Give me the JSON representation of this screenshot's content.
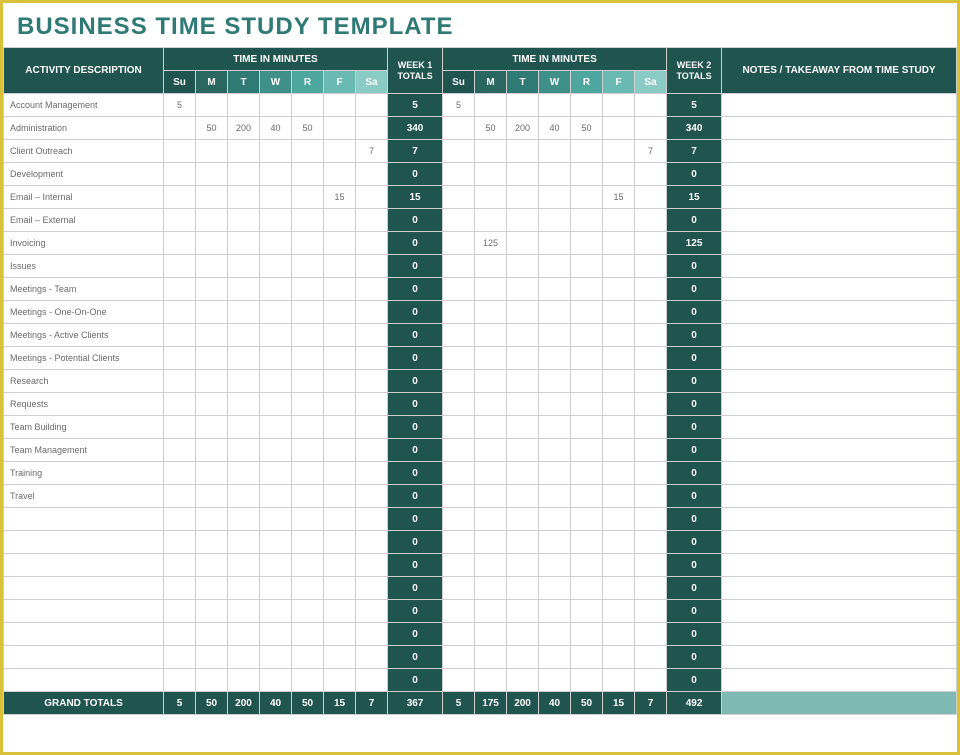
{
  "title": "BUSINESS TIME STUDY TEMPLATE",
  "headers": {
    "activity": "ACTIVITY DESCRIPTION",
    "time_in_minutes": "TIME IN MINUTES",
    "week1_totals": "WEEK 1 TOTALS",
    "week2_totals": "WEEK 2 TOTALS",
    "notes": "NOTES / TAKEAWAY FROM TIME STUDY",
    "days": [
      "Su",
      "M",
      "T",
      "W",
      "R",
      "F",
      "Sa"
    ],
    "grand_totals": "GRAND TOTALS"
  },
  "rows": [
    {
      "activity": "Account Management",
      "w1": [
        "5",
        "",
        "",
        "",
        "",
        "",
        ""
      ],
      "t1": "5",
      "w2": [
        "5",
        "",
        "",
        "",
        "",
        "",
        ""
      ],
      "t2": "5",
      "notes": ""
    },
    {
      "activity": "Administration",
      "w1": [
        "",
        "50",
        "200",
        "40",
        "50",
        "",
        ""
      ],
      "t1": "340",
      "w2": [
        "",
        "50",
        "200",
        "40",
        "50",
        "",
        ""
      ],
      "t2": "340",
      "notes": ""
    },
    {
      "activity": "Client Outreach",
      "w1": [
        "",
        "",
        "",
        "",
        "",
        "",
        "7"
      ],
      "t1": "7",
      "w2": [
        "",
        "",
        "",
        "",
        "",
        "",
        "7"
      ],
      "t2": "7",
      "notes": ""
    },
    {
      "activity": "Development",
      "w1": [
        "",
        "",
        "",
        "",
        "",
        "",
        ""
      ],
      "t1": "0",
      "w2": [
        "",
        "",
        "",
        "",
        "",
        "",
        ""
      ],
      "t2": "0",
      "notes": ""
    },
    {
      "activity": "Email – Internal",
      "w1": [
        "",
        "",
        "",
        "",
        "",
        "15",
        ""
      ],
      "t1": "15",
      "w2": [
        "",
        "",
        "",
        "",
        "",
        "15",
        ""
      ],
      "t2": "15",
      "notes": ""
    },
    {
      "activity": "Email – External",
      "w1": [
        "",
        "",
        "",
        "",
        "",
        "",
        ""
      ],
      "t1": "0",
      "w2": [
        "",
        "",
        "",
        "",
        "",
        "",
        ""
      ],
      "t2": "0",
      "notes": ""
    },
    {
      "activity": "Invoicing",
      "w1": [
        "",
        "",
        "",
        "",
        "",
        "",
        ""
      ],
      "t1": "0",
      "w2": [
        "",
        "125",
        "",
        "",
        "",
        "",
        ""
      ],
      "t2": "125",
      "notes": ""
    },
    {
      "activity": "Issues",
      "w1": [
        "",
        "",
        "",
        "",
        "",
        "",
        ""
      ],
      "t1": "0",
      "w2": [
        "",
        "",
        "",
        "",
        "",
        "",
        ""
      ],
      "t2": "0",
      "notes": ""
    },
    {
      "activity": "Meetings - Team",
      "w1": [
        "",
        "",
        "",
        "",
        "",
        "",
        ""
      ],
      "t1": "0",
      "w2": [
        "",
        "",
        "",
        "",
        "",
        "",
        ""
      ],
      "t2": "0",
      "notes": ""
    },
    {
      "activity": "Meetings - One-On-One",
      "w1": [
        "",
        "",
        "",
        "",
        "",
        "",
        ""
      ],
      "t1": "0",
      "w2": [
        "",
        "",
        "",
        "",
        "",
        "",
        ""
      ],
      "t2": "0",
      "notes": ""
    },
    {
      "activity": "Meetings - Active Clients",
      "w1": [
        "",
        "",
        "",
        "",
        "",
        "",
        ""
      ],
      "t1": "0",
      "w2": [
        "",
        "",
        "",
        "",
        "",
        "",
        ""
      ],
      "t2": "0",
      "notes": ""
    },
    {
      "activity": "Meetings - Potential Clients",
      "w1": [
        "",
        "",
        "",
        "",
        "",
        "",
        ""
      ],
      "t1": "0",
      "w2": [
        "",
        "",
        "",
        "",
        "",
        "",
        ""
      ],
      "t2": "0",
      "notes": ""
    },
    {
      "activity": "Research",
      "w1": [
        "",
        "",
        "",
        "",
        "",
        "",
        ""
      ],
      "t1": "0",
      "w2": [
        "",
        "",
        "",
        "",
        "",
        "",
        ""
      ],
      "t2": "0",
      "notes": ""
    },
    {
      "activity": "Requests",
      "w1": [
        "",
        "",
        "",
        "",
        "",
        "",
        ""
      ],
      "t1": "0",
      "w2": [
        "",
        "",
        "",
        "",
        "",
        "",
        ""
      ],
      "t2": "0",
      "notes": ""
    },
    {
      "activity": "Team Building",
      "w1": [
        "",
        "",
        "",
        "",
        "",
        "",
        ""
      ],
      "t1": "0",
      "w2": [
        "",
        "",
        "",
        "",
        "",
        "",
        ""
      ],
      "t2": "0",
      "notes": ""
    },
    {
      "activity": "Team Management",
      "w1": [
        "",
        "",
        "",
        "",
        "",
        "",
        ""
      ],
      "t1": "0",
      "w2": [
        "",
        "",
        "",
        "",
        "",
        "",
        ""
      ],
      "t2": "0",
      "notes": ""
    },
    {
      "activity": "Training",
      "w1": [
        "",
        "",
        "",
        "",
        "",
        "",
        ""
      ],
      "t1": "0",
      "w2": [
        "",
        "",
        "",
        "",
        "",
        "",
        ""
      ],
      "t2": "0",
      "notes": ""
    },
    {
      "activity": "Travel",
      "w1": [
        "",
        "",
        "",
        "",
        "",
        "",
        ""
      ],
      "t1": "0",
      "w2": [
        "",
        "",
        "",
        "",
        "",
        "",
        ""
      ],
      "t2": "0",
      "notes": ""
    },
    {
      "activity": "",
      "w1": [
        "",
        "",
        "",
        "",
        "",
        "",
        ""
      ],
      "t1": "0",
      "w2": [
        "",
        "",
        "",
        "",
        "",
        "",
        ""
      ],
      "t2": "0",
      "notes": ""
    },
    {
      "activity": "",
      "w1": [
        "",
        "",
        "",
        "",
        "",
        "",
        ""
      ],
      "t1": "0",
      "w2": [
        "",
        "",
        "",
        "",
        "",
        "",
        ""
      ],
      "t2": "0",
      "notes": ""
    },
    {
      "activity": "",
      "w1": [
        "",
        "",
        "",
        "",
        "",
        "",
        ""
      ],
      "t1": "0",
      "w2": [
        "",
        "",
        "",
        "",
        "",
        "",
        ""
      ],
      "t2": "0",
      "notes": ""
    },
    {
      "activity": "",
      "w1": [
        "",
        "",
        "",
        "",
        "",
        "",
        ""
      ],
      "t1": "0",
      "w2": [
        "",
        "",
        "",
        "",
        "",
        "",
        ""
      ],
      "t2": "0",
      "notes": ""
    },
    {
      "activity": "",
      "w1": [
        "",
        "",
        "",
        "",
        "",
        "",
        ""
      ],
      "t1": "0",
      "w2": [
        "",
        "",
        "",
        "",
        "",
        "",
        ""
      ],
      "t2": "0",
      "notes": ""
    },
    {
      "activity": "",
      "w1": [
        "",
        "",
        "",
        "",
        "",
        "",
        ""
      ],
      "t1": "0",
      "w2": [
        "",
        "",
        "",
        "",
        "",
        "",
        ""
      ],
      "t2": "0",
      "notes": ""
    },
    {
      "activity": "",
      "w1": [
        "",
        "",
        "",
        "",
        "",
        "",
        ""
      ],
      "t1": "0",
      "w2": [
        "",
        "",
        "",
        "",
        "",
        "",
        ""
      ],
      "t2": "0",
      "notes": ""
    },
    {
      "activity": "",
      "w1": [
        "",
        "",
        "",
        "",
        "",
        "",
        ""
      ],
      "t1": "0",
      "w2": [
        "",
        "",
        "",
        "",
        "",
        "",
        ""
      ],
      "t2": "0",
      "notes": ""
    }
  ],
  "grand_totals": {
    "w1": [
      "5",
      "50",
      "200",
      "40",
      "50",
      "15",
      "7"
    ],
    "t1": "367",
    "w2": [
      "5",
      "175",
      "200",
      "40",
      "50",
      "15",
      "7"
    ],
    "t2": "492"
  }
}
